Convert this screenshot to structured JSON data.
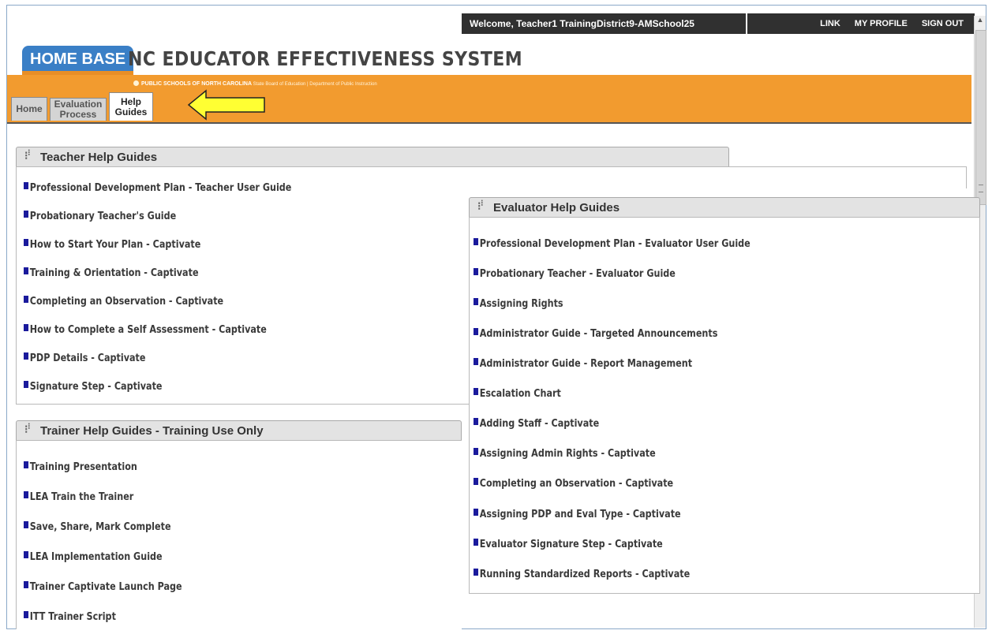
{
  "header": {
    "welcome": "Welcome, Teacher1 TrainingDistrict9-AMSchool25",
    "links": [
      "LINK",
      "MY PROFILE",
      "SIGN OUT"
    ],
    "logo": "HOME BASE",
    "title": "NC EDUCATOR EFFECTIVENESS SYSTEM",
    "subtitle_bold": "PUBLIC SCHOOLS OF NORTH CAROLINA",
    "subtitle_rest": "State Board of Education | Department of Public Instruction"
  },
  "tabs": [
    {
      "label": "Home"
    },
    {
      "label": "Evaluation Process"
    },
    {
      "label": "Help Guides"
    }
  ],
  "teacher_panel": {
    "title": "Teacher Help Guides",
    "items": [
      "Professional Development Plan - Teacher User Guide",
      "Probationary Teacher's Guide",
      "How to Start Your Plan - Captivate",
      "Training & Orientation - Captivate",
      "Completing an Observation - Captivate",
      "How to Complete a Self Assessment - Captivate",
      "PDP Details - Captivate",
      "Signature Step - Captivate"
    ]
  },
  "trainer_panel": {
    "title": "Trainer Help Guides - Training Use Only",
    "items": [
      "Training Presentation",
      "LEA Train the Trainer",
      "Save, Share, Mark Complete",
      "LEA Implementation Guide",
      "Trainer Captivate Launch Page",
      "ITT Trainer Script"
    ]
  },
  "evaluator_panel": {
    "title": "Evaluator Help Guides",
    "items": [
      "Professional Development Plan - Evaluator User Guide",
      "Probationary Teacher - Evaluator Guide",
      "Assigning Rights",
      "Administrator Guide - Targeted Announcements",
      "Administrator Guide - Report Management",
      "Escalation Chart",
      "Adding Staff - Captivate",
      "Assigning Admin Rights - Captivate",
      "Completing an Observation - Captivate",
      "Assigning PDP and Eval Type - Captivate",
      "Evaluator Signature Step - Captivate",
      "Running Standardized Reports - Captivate"
    ]
  },
  "colors": {
    "orange": "#f29b2f",
    "bullet": "#1a1a9c",
    "arrow_fill": "#ffff33"
  }
}
